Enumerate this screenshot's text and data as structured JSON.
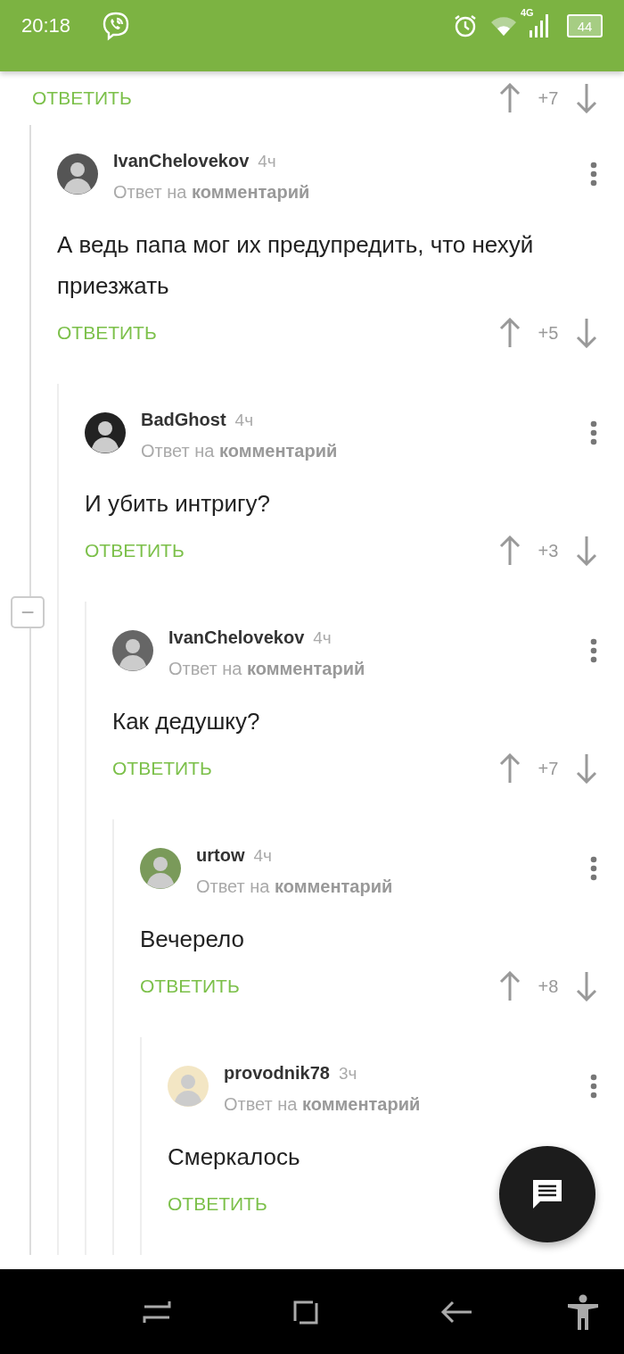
{
  "status_bar": {
    "time": "20:18",
    "network": "4G",
    "battery": "44"
  },
  "parent_actions": {
    "reply": "ОТВЕТИТЬ",
    "score": "+7"
  },
  "collapse_button": {
    "label": "−"
  },
  "comments": [
    {
      "author": "IvanChelovekov",
      "time": "4ч",
      "reply_to": "Ответ на **комментарий**",
      "text": "А ведь папа мог их предупредить, что нехуй приезжать",
      "reply": "ОТВЕТИТЬ",
      "score": "+5",
      "children": [
        {
          "author": "BadGhost",
          "time": "4ч",
          "reply_to": "Ответ на **комментарий**",
          "text": "И убить интригу?",
          "reply": "ОТВЕТИТЬ",
          "score": "+3",
          "children": [
            {
              "author": "IvanChelovekov",
              "time": "4ч",
              "reply_to": "Ответ на **комментарий**",
              "text": "Как дедушку?",
              "reply": "ОТВЕТИТЬ",
              "score": "+7",
              "children": [
                {
                  "author": "urtow",
                  "time": "4ч",
                  "reply_to": "Ответ на **комментарий**",
                  "text": "Вечерело",
                  "reply": "ОТВЕТИТЬ",
                  "score": "+8",
                  "children": [
                    {
                      "author": "provodnik78",
                      "time": "3ч",
                      "reply_to": "Ответ на **комментарий**",
                      "text": "Смеркалось",
                      "reply": "ОТВЕТИТЬ"
                    }
                  ]
                }
              ]
            }
          ]
        }
      ]
    }
  ]
}
